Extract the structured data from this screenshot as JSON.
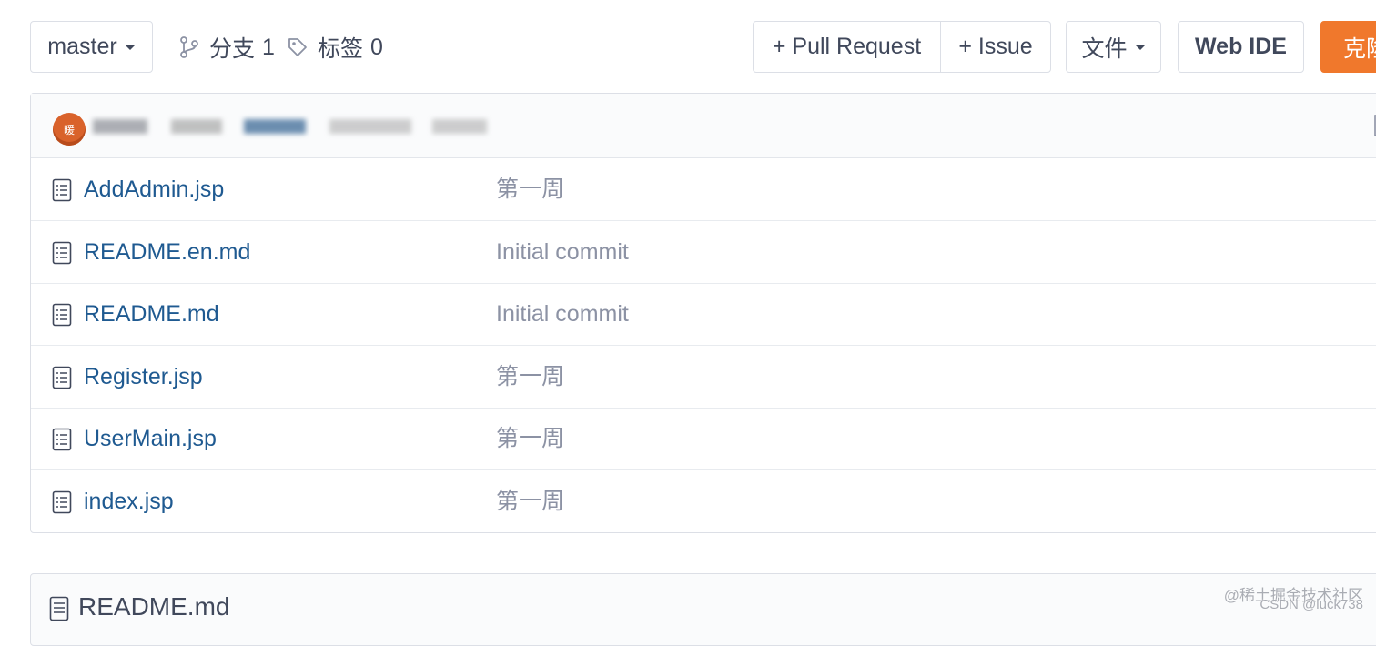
{
  "toolbar": {
    "branch": "master",
    "branches_label": "分支",
    "branches_count": "1",
    "tags_label": "标签",
    "tags_count": "0",
    "pull_request": "+ Pull Request",
    "issue": "+ Issue",
    "files_menu": "文件",
    "web_ide": "Web IDE",
    "clone": "克隆"
  },
  "latest_commit": {
    "avatar_text": "暖",
    "text": "",
    "accent": "#d9622b"
  },
  "files": [
    {
      "name": "AddAdmin.jsp",
      "commit": "第一周",
      "icon": "file-icon"
    },
    {
      "name": "README.en.md",
      "commit": "Initial commit",
      "icon": "file-icon"
    },
    {
      "name": "README.md",
      "commit": "Initial commit",
      "icon": "file-icon"
    },
    {
      "name": "Register.jsp",
      "commit": "第一周",
      "icon": "file-icon"
    },
    {
      "name": "UserMain.jsp",
      "commit": "第一周",
      "icon": "file-icon"
    },
    {
      "name": "index.jsp",
      "commit": "第一周",
      "icon": "file-icon"
    }
  ],
  "readme": {
    "title": "README.md"
  },
  "watermark": {
    "line1": "@稀土掘金技术社区",
    "line2": "CSDN @luck738"
  },
  "colors": {
    "link": "#1f5a91",
    "muted": "#8c92a4",
    "clone_button": "#f0782c",
    "border": "#dcdfe6"
  }
}
